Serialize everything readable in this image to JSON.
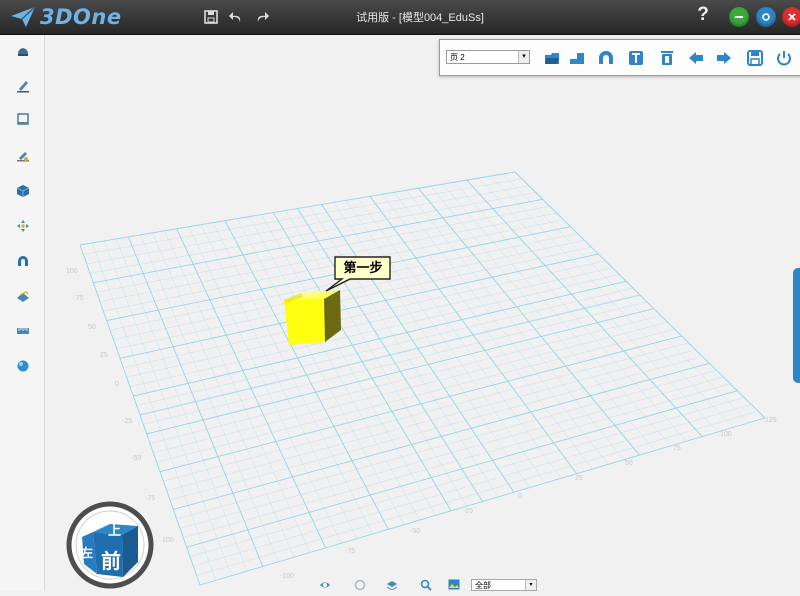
{
  "app": {
    "brand": "3DOne",
    "title": "试用版 - [模型004_EduSs]",
    "help": "?"
  },
  "top_panel": {
    "page_value": "页 2"
  },
  "callout": {
    "text": "第一步"
  },
  "viewcube": {
    "top_face": "上",
    "front_face": "前",
    "left_face": "左"
  },
  "bottom": {
    "filter_value": "全部"
  },
  "grid": {
    "x_ticks": [
      "-100",
      "-75",
      "-50",
      "-25",
      "0",
      "25",
      "50",
      "75",
      "100",
      "125"
    ],
    "y_ticks": [
      "100",
      "75",
      "50",
      "25",
      "0",
      "-25",
      "-50",
      "-75",
      "100"
    ]
  },
  "colors": {
    "accent": "#2f86c7",
    "grid": "#8fd3ea",
    "cube": "#ffff00",
    "titlebar": "#333333"
  },
  "icons": {
    "titlebar": [
      "save-icon",
      "undo-icon",
      "redo-icon"
    ],
    "left_toolbar": [
      "basic-solid-icon",
      "sketch-icon",
      "sketch-edit-icon",
      "special-function-icon",
      "features-icon",
      "transform-icon",
      "combine-icon",
      "pattern-icon",
      "measure-icon",
      "color-ball-icon"
    ],
    "top_panel": [
      "open-icon",
      "step-icon",
      "arc-icon",
      "text-icon",
      "delete-icon",
      "previous-icon",
      "next-icon",
      "save-icon",
      "power-icon"
    ],
    "bottom": [
      "eye-icon",
      "circle-icon",
      "layer-icon",
      "search-icon",
      "picture-icon"
    ]
  }
}
